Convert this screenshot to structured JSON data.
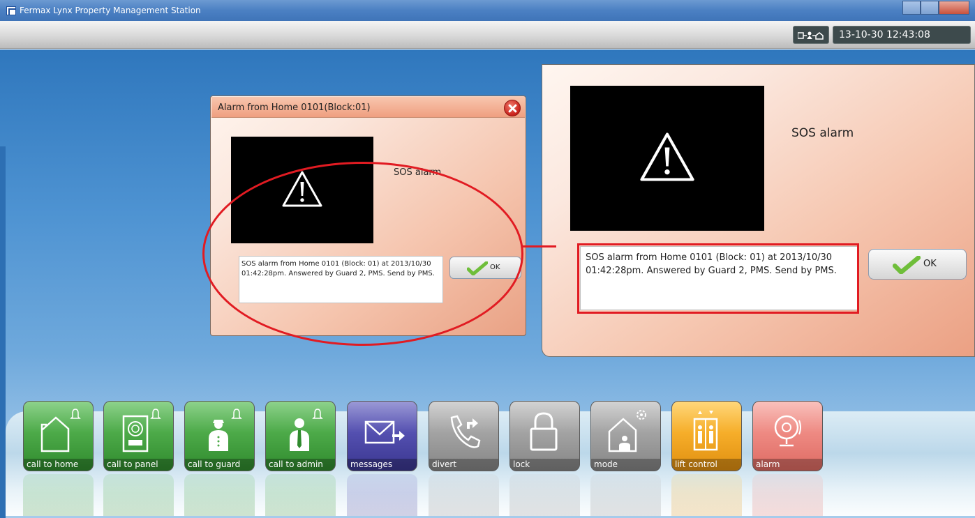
{
  "window": {
    "title": "Fermax Lynx Property Management Station"
  },
  "toolbar": {
    "connection_icon": "network-status-icon",
    "datetime": "13-10-30 12:43:08"
  },
  "dialog": {
    "title": "Alarm from Home 0101(Block:01)",
    "alarm_type": "SOS alarm",
    "message": "SOS alarm from Home 0101 (Block: 01) at 2013/10/30 01:42:28pm. Answered by Guard 2, PMS. Send by PMS.",
    "ok_label": "OK"
  },
  "zoom": {
    "alarm_type": "SOS alarm",
    "message": "SOS alarm from Home 0101 (Block: 01) at 2013/10/30 01:42:28pm. Answered by Guard 2, PMS. Send by PMS.",
    "ok_label": "OK"
  },
  "annotation_color": "#e11b22",
  "dock": [
    {
      "label": "call to home",
      "icon": "house-bell-icon",
      "color": "green"
    },
    {
      "label": "call to panel",
      "icon": "panel-bell-icon",
      "color": "green"
    },
    {
      "label": "call to guard",
      "icon": "guard-bell-icon",
      "color": "green"
    },
    {
      "label": "call to admin",
      "icon": "admin-bell-icon",
      "color": "green"
    },
    {
      "label": "messages",
      "icon": "envelope-icon",
      "color": "blue"
    },
    {
      "label": "divert",
      "icon": "phone-divert-icon",
      "color": "gray"
    },
    {
      "label": "lock",
      "icon": "padlock-icon",
      "color": "gray"
    },
    {
      "label": "mode",
      "icon": "house-gear-icon",
      "color": "gray"
    },
    {
      "label": "lift control",
      "icon": "elevator-icon",
      "color": "orange"
    },
    {
      "label": "alarm",
      "icon": "alarm-bell-icon",
      "color": "pink"
    }
  ]
}
